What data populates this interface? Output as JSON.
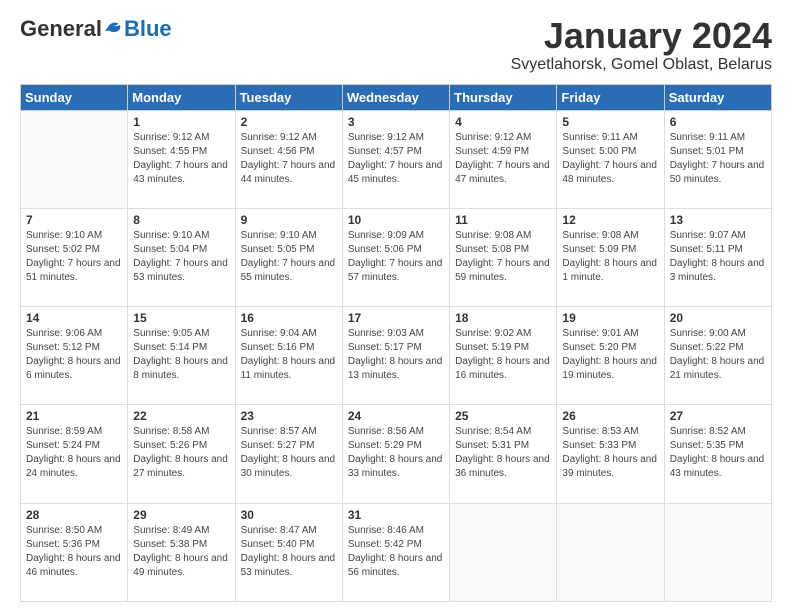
{
  "logo": {
    "general": "General",
    "blue": "Blue"
  },
  "header": {
    "title": "January 2024",
    "subtitle": "Svyetlahorsk, Gomel Oblast, Belarus"
  },
  "weekdays": [
    "Sunday",
    "Monday",
    "Tuesday",
    "Wednesday",
    "Thursday",
    "Friday",
    "Saturday"
  ],
  "weeks": [
    [
      {
        "date": "",
        "sunrise": "",
        "sunset": "",
        "daylight": ""
      },
      {
        "date": "1",
        "sunrise": "9:12 AM",
        "sunset": "4:55 PM",
        "daylight": "7 hours and 43 minutes."
      },
      {
        "date": "2",
        "sunrise": "9:12 AM",
        "sunset": "4:56 PM",
        "daylight": "7 hours and 44 minutes."
      },
      {
        "date": "3",
        "sunrise": "9:12 AM",
        "sunset": "4:57 PM",
        "daylight": "7 hours and 45 minutes."
      },
      {
        "date": "4",
        "sunrise": "9:12 AM",
        "sunset": "4:59 PM",
        "daylight": "7 hours and 47 minutes."
      },
      {
        "date": "5",
        "sunrise": "9:11 AM",
        "sunset": "5:00 PM",
        "daylight": "7 hours and 48 minutes."
      },
      {
        "date": "6",
        "sunrise": "9:11 AM",
        "sunset": "5:01 PM",
        "daylight": "7 hours and 50 minutes."
      }
    ],
    [
      {
        "date": "7",
        "sunrise": "9:10 AM",
        "sunset": "5:02 PM",
        "daylight": "7 hours and 51 minutes."
      },
      {
        "date": "8",
        "sunrise": "9:10 AM",
        "sunset": "5:04 PM",
        "daylight": "7 hours and 53 minutes."
      },
      {
        "date": "9",
        "sunrise": "9:10 AM",
        "sunset": "5:05 PM",
        "daylight": "7 hours and 55 minutes."
      },
      {
        "date": "10",
        "sunrise": "9:09 AM",
        "sunset": "5:06 PM",
        "daylight": "7 hours and 57 minutes."
      },
      {
        "date": "11",
        "sunrise": "9:08 AM",
        "sunset": "5:08 PM",
        "daylight": "7 hours and 59 minutes."
      },
      {
        "date": "12",
        "sunrise": "9:08 AM",
        "sunset": "5:09 PM",
        "daylight": "8 hours and 1 minute."
      },
      {
        "date": "13",
        "sunrise": "9:07 AM",
        "sunset": "5:11 PM",
        "daylight": "8 hours and 3 minutes."
      }
    ],
    [
      {
        "date": "14",
        "sunrise": "9:06 AM",
        "sunset": "5:12 PM",
        "daylight": "8 hours and 6 minutes."
      },
      {
        "date": "15",
        "sunrise": "9:05 AM",
        "sunset": "5:14 PM",
        "daylight": "8 hours and 8 minutes."
      },
      {
        "date": "16",
        "sunrise": "9:04 AM",
        "sunset": "5:16 PM",
        "daylight": "8 hours and 11 minutes."
      },
      {
        "date": "17",
        "sunrise": "9:03 AM",
        "sunset": "5:17 PM",
        "daylight": "8 hours and 13 minutes."
      },
      {
        "date": "18",
        "sunrise": "9:02 AM",
        "sunset": "5:19 PM",
        "daylight": "8 hours and 16 minutes."
      },
      {
        "date": "19",
        "sunrise": "9:01 AM",
        "sunset": "5:20 PM",
        "daylight": "8 hours and 19 minutes."
      },
      {
        "date": "20",
        "sunrise": "9:00 AM",
        "sunset": "5:22 PM",
        "daylight": "8 hours and 21 minutes."
      }
    ],
    [
      {
        "date": "21",
        "sunrise": "8:59 AM",
        "sunset": "5:24 PM",
        "daylight": "8 hours and 24 minutes."
      },
      {
        "date": "22",
        "sunrise": "8:58 AM",
        "sunset": "5:26 PM",
        "daylight": "8 hours and 27 minutes."
      },
      {
        "date": "23",
        "sunrise": "8:57 AM",
        "sunset": "5:27 PM",
        "daylight": "8 hours and 30 minutes."
      },
      {
        "date": "24",
        "sunrise": "8:56 AM",
        "sunset": "5:29 PM",
        "daylight": "8 hours and 33 minutes."
      },
      {
        "date": "25",
        "sunrise": "8:54 AM",
        "sunset": "5:31 PM",
        "daylight": "8 hours and 36 minutes."
      },
      {
        "date": "26",
        "sunrise": "8:53 AM",
        "sunset": "5:33 PM",
        "daylight": "8 hours and 39 minutes."
      },
      {
        "date": "27",
        "sunrise": "8:52 AM",
        "sunset": "5:35 PM",
        "daylight": "8 hours and 43 minutes."
      }
    ],
    [
      {
        "date": "28",
        "sunrise": "8:50 AM",
        "sunset": "5:36 PM",
        "daylight": "8 hours and 46 minutes."
      },
      {
        "date": "29",
        "sunrise": "8:49 AM",
        "sunset": "5:38 PM",
        "daylight": "8 hours and 49 minutes."
      },
      {
        "date": "30",
        "sunrise": "8:47 AM",
        "sunset": "5:40 PM",
        "daylight": "8 hours and 53 minutes."
      },
      {
        "date": "31",
        "sunrise": "8:46 AM",
        "sunset": "5:42 PM",
        "daylight": "8 hours and 56 minutes."
      },
      {
        "date": "",
        "sunrise": "",
        "sunset": "",
        "daylight": ""
      },
      {
        "date": "",
        "sunrise": "",
        "sunset": "",
        "daylight": ""
      },
      {
        "date": "",
        "sunrise": "",
        "sunset": "",
        "daylight": ""
      }
    ]
  ]
}
